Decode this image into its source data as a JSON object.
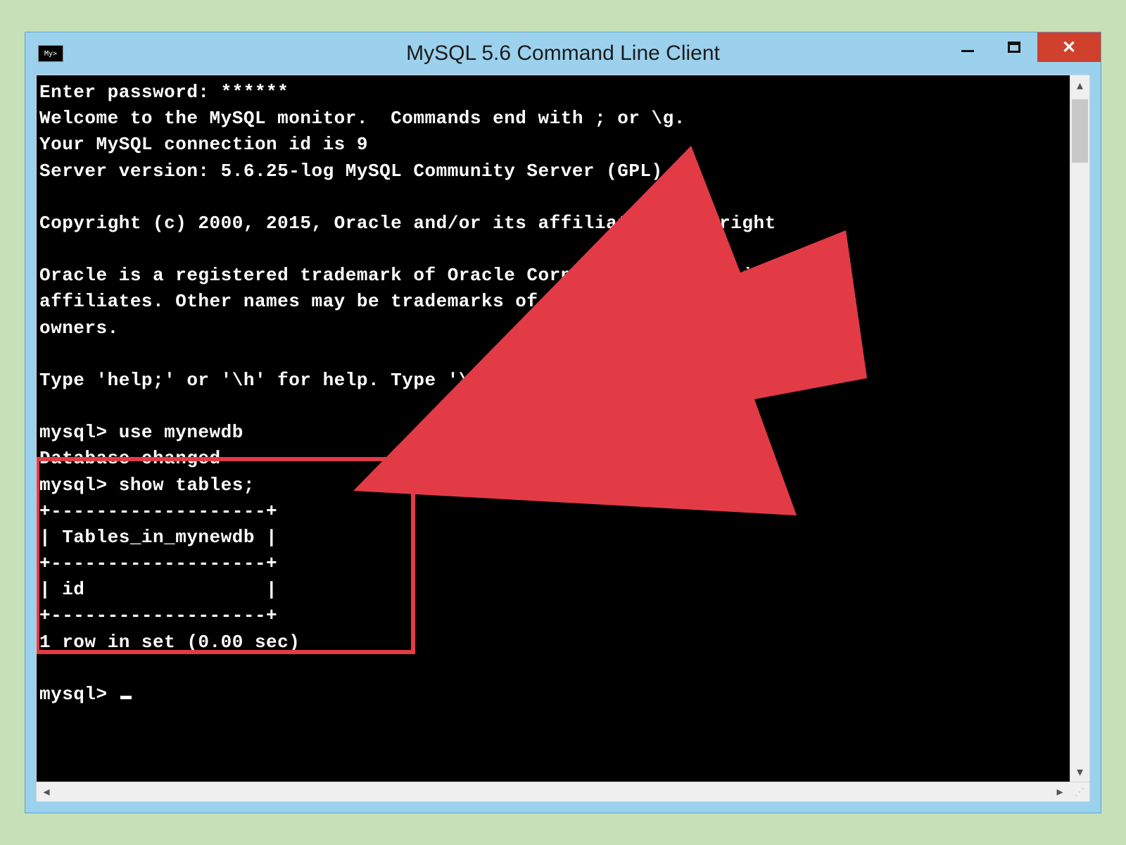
{
  "window": {
    "title": "MySQL 5.6 Command Line Client",
    "icon_label": "My>"
  },
  "console": {
    "lines": [
      "Enter password: ******",
      "Welcome to the MySQL monitor.  Commands end with ; or \\g.",
      "Your MySQL connection id is 9",
      "Server version: 5.6.25-log MySQL Community Server (GPL)",
      "",
      "Copyright (c) 2000, 2015, Oracle and/or its affiliates. All right",
      "",
      "Oracle is a registered trademark of Oracle Corporation and/or its",
      "affiliates. Other names may be trademarks of their respective",
      "owners.",
      "",
      "Type 'help;' or '\\h' for help. Type '\\c' to clear the current inp",
      "",
      "mysql> use mynewdb",
      "Database changed",
      "mysql> show tables;",
      "+-------------------+",
      "| Tables_in_mynewdb |",
      "+-------------------+",
      "| id                |",
      "+-------------------+",
      "1 row in set (0.00 sec)",
      "",
      "mysql> "
    ]
  },
  "overlay": {
    "highlight_color": "#e23b46",
    "arrow_color": "#e23b46"
  }
}
